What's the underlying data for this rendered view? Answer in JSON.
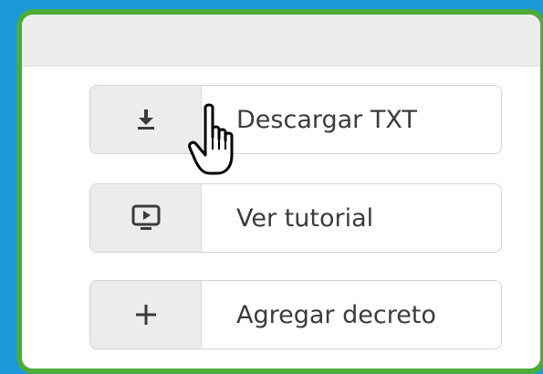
{
  "buttons": {
    "download": {
      "label": "Descargar TXT",
      "icon": "download-icon"
    },
    "tutorial": {
      "label": "Ver tutorial",
      "icon": "play-screen-icon"
    },
    "add": {
      "label": "Agregar decreto",
      "icon": "plus-icon"
    }
  },
  "colors": {
    "background": "#1a9ad6",
    "frame_border": "#4dab3c",
    "icon_cell": "#ececec",
    "text": "#3b3b3b"
  },
  "cursor": {
    "icon": "hand-pointer-icon"
  }
}
